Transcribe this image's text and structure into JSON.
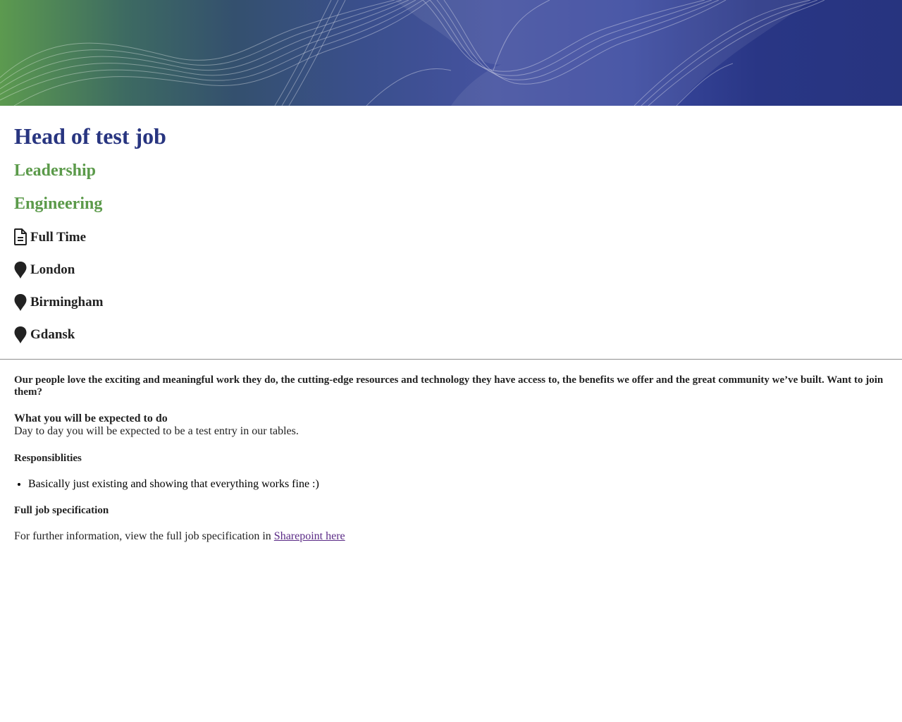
{
  "banner": {
    "colors": {
      "left": "#5c9a4f",
      "mid": "#3d4f97",
      "right": "#27347f"
    }
  },
  "job": {
    "title": "Head of test job",
    "categories": [
      "Leadership",
      "Engineering"
    ],
    "type": "Full Time",
    "locations": [
      "London",
      "Birmingham",
      "Gdansk"
    ],
    "icons": {
      "type": "document-icon",
      "location": "map-pin-icon"
    }
  },
  "description": {
    "intro": "Our people love the exciting and meaningful work they do, the cutting-edge resources and technology they have access to, the benefits we offer and the great community we’ve built. Want to join them?",
    "expect_heading": "What you will be expected to do",
    "expect_body": "Day to day you will be expected to be a test entry in our tables.",
    "responsibilities_heading": "Responsiblities",
    "responsibilities": [
      "Basically just existing and showing that everything works fine :)"
    ],
    "spec_heading": "Full job specification",
    "further_text": "For further information, view the full job specification in ",
    "link_text": "Sharepoint here"
  },
  "colors": {
    "title": "#283580",
    "category": "#5b9a4a",
    "link": "#5a2a86"
  }
}
